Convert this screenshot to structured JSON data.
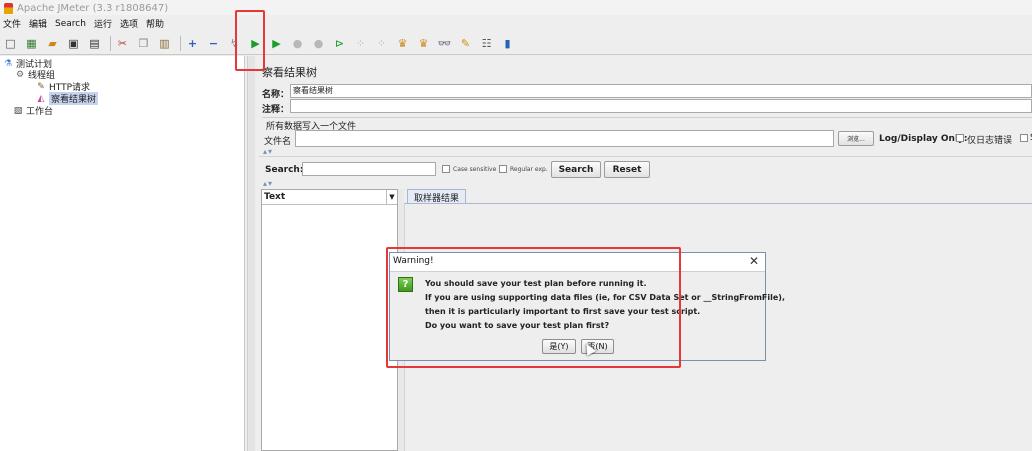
{
  "window": {
    "title": "Apache JMeter (3.3 r1808647)"
  },
  "menu": {
    "items": [
      "文件",
      "编辑",
      "Search",
      "运行",
      "选项",
      "帮助"
    ]
  },
  "toolbar": {
    "buttons": [
      {
        "icon": "new-icon",
        "glyph": "□"
      },
      {
        "icon": "templates-icon",
        "glyph": "▦"
      },
      {
        "icon": "open-icon",
        "glyph": "▰"
      },
      {
        "icon": "save-icon",
        "glyph": "▣"
      },
      {
        "icon": "save-as-icon",
        "glyph": "▤"
      },
      {
        "icon": "cut-icon",
        "glyph": "✂"
      },
      {
        "icon": "copy-icon",
        "glyph": "❐"
      },
      {
        "icon": "paste-icon",
        "glyph": "▥"
      },
      {
        "icon": "expand-icon",
        "glyph": "+"
      },
      {
        "icon": "collapse-icon",
        "glyph": "−"
      },
      {
        "icon": "toggle-icon",
        "glyph": "↯"
      },
      {
        "icon": "start-icon",
        "glyph": "▶"
      },
      {
        "icon": "start-no-pause-icon",
        "glyph": "▶"
      },
      {
        "icon": "stop-icon",
        "glyph": "●"
      },
      {
        "icon": "shutdown-icon",
        "glyph": "●"
      },
      {
        "icon": "remote-start-icon",
        "glyph": "⊳"
      },
      {
        "icon": "remote-stop-icon",
        "glyph": "⁘"
      },
      {
        "icon": "remote-exit-icon",
        "glyph": "⁘"
      },
      {
        "icon": "clear-icon",
        "glyph": "♛"
      },
      {
        "icon": "clear-all-icon",
        "glyph": "♛"
      },
      {
        "icon": "search-icon",
        "glyph": "👓"
      },
      {
        "icon": "reset-search-icon",
        "glyph": "✎"
      },
      {
        "icon": "function-helper-icon",
        "glyph": "☷"
      },
      {
        "icon": "help-icon",
        "glyph": "▮"
      }
    ]
  },
  "tree": {
    "nodes": [
      {
        "label": "测试计划",
        "icon": "flask-icon",
        "selected": false
      },
      {
        "label": "线程组",
        "icon": "gear-icon",
        "selected": false
      },
      {
        "label": "HTTP请求",
        "icon": "pencil-icon",
        "selected": false
      },
      {
        "label": "察看结果树",
        "icon": "listener-icon",
        "selected": true
      },
      {
        "label": "工作台",
        "icon": "workbench-icon",
        "selected": false
      }
    ]
  },
  "panel": {
    "title": "察看结果树",
    "name_label": "名称：",
    "name_value": "察看结果树",
    "comment_label": "注释：",
    "comment_value": "",
    "file_group_title": "所有数据写入一个文件",
    "file_label": "文件名",
    "file_value": "",
    "browse_label": "浏览...",
    "log_display_label": "Log/Display Only:",
    "errors_only_label": "仅日志错误",
    "successes_partial": "S",
    "search_label": "Search:",
    "search_value": "",
    "case_sensitive_label": "Case sensitive",
    "regex_label": "Regular exp.",
    "search_button": "Search",
    "reset_button": "Reset",
    "renderer_selected": "Text",
    "tab_label": "取样器结果"
  },
  "dialog": {
    "title": "Warning!",
    "line1": "You should save your test plan before running it.",
    "line2": "If you are using supporting data files (ie, for CSV Data Set or __StringFromFile),",
    "line3": "then it is particularly important to first save your test script.",
    "line4": "Do you want to save your test plan first?",
    "yes_button": "是(Y)",
    "no_button": "否(N)"
  }
}
